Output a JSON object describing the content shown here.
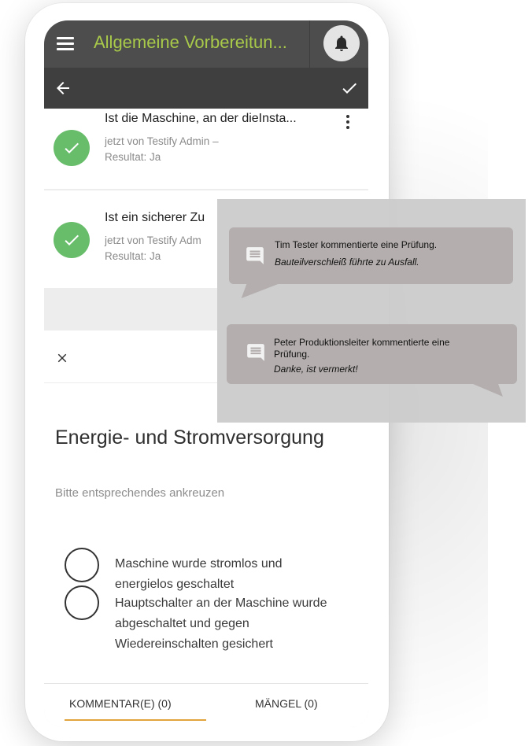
{
  "app": {
    "title": "Allgemeine Vorbereitun...",
    "menu_icon": "hamburger-menu-icon",
    "bell_icon": "bell-icon",
    "accent_color": "#a8c94a"
  },
  "subbar": {
    "back_icon": "arrow-left-icon",
    "confirm_icon": "checkmark-icon"
  },
  "checks": [
    {
      "title": "Ist die Maschine, an der dieInsta...",
      "meta_line1": "jetzt von Testify Admin –",
      "meta_line2": "Resultat: Ja",
      "status_color": "#68bd6b"
    },
    {
      "title": "Ist ein sicherer Zu",
      "meta_line1": "jetzt von Testify Adm",
      "meta_line2": "Resultat: Ja",
      "status_color": "#68bd6b"
    }
  ],
  "detail": {
    "section_title": "Energie- und Stromversorgung",
    "instruction": "Bitte entsprechendes ankreuzen",
    "options": [
      "Maschine wurde stromlos und energielos geschaltet",
      "Hauptschalter an der Maschine wurde abgeschaltet und gegen Wiedereinschalten gesichert"
    ],
    "tabs": {
      "comments": "KOMMENTAR(E) (0)",
      "defects": "MÄNGEL (0)",
      "active_color": "#e2a43c"
    }
  },
  "notifications": [
    {
      "author": "Tim Tester kommentierte eine Prüfung.",
      "text": "Bauteilverschleiß führte zu Ausfall."
    },
    {
      "author": "Peter Produktionsleiter kommentierte eine Prüfung.",
      "text": "Danke, ist vermerkt!"
    }
  ]
}
